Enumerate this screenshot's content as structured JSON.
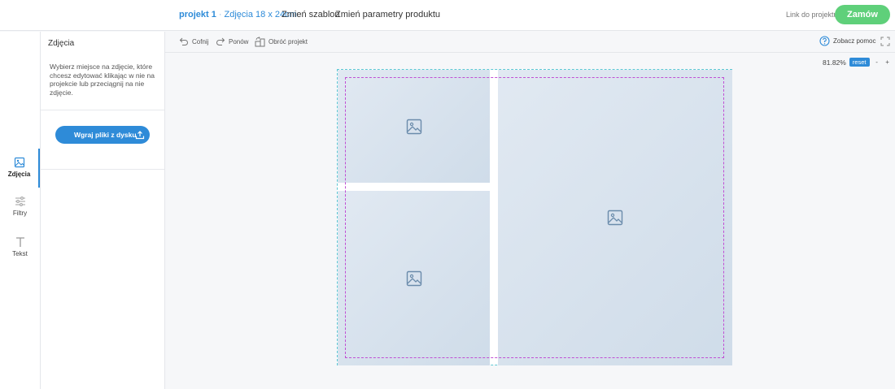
{
  "header": {
    "project_name": "projekt 1",
    "product": "Zdjęcia 18 x 24cm",
    "change_template": "Zmień szablon",
    "change_params": "Zmień parametry produktu",
    "project_link": "Link do projektu",
    "order_button": "Zamów"
  },
  "rail": {
    "items": [
      {
        "label": "Zdjęcia",
        "icon": "image-icon",
        "active": true
      },
      {
        "label": "Filtry",
        "icon": "sliders-icon",
        "active": false
      },
      {
        "label": "Tekst",
        "icon": "text-icon",
        "active": false
      }
    ]
  },
  "panel": {
    "title": "Zdjęcia",
    "description": "Wybierz miejsce na zdjęcie, które chcesz edytować klikając w nie na projekcie lub przeciągnij na nie zdjęcie.",
    "upload_button": "Wgraj pliki z dysku"
  },
  "toolbar": {
    "undo": "Cofnij",
    "redo": "Ponów",
    "rotate": "Obróć projekt",
    "help": "Zobacz pomoc"
  },
  "zoom": {
    "level": "81.82%",
    "reset": "reset",
    "minus": "-",
    "plus": "+"
  },
  "colors": {
    "accent": "#2e8bd8",
    "order": "#5fd07a",
    "bleed_line": "#5ec8d4",
    "safe_line": "#c04fd4"
  }
}
